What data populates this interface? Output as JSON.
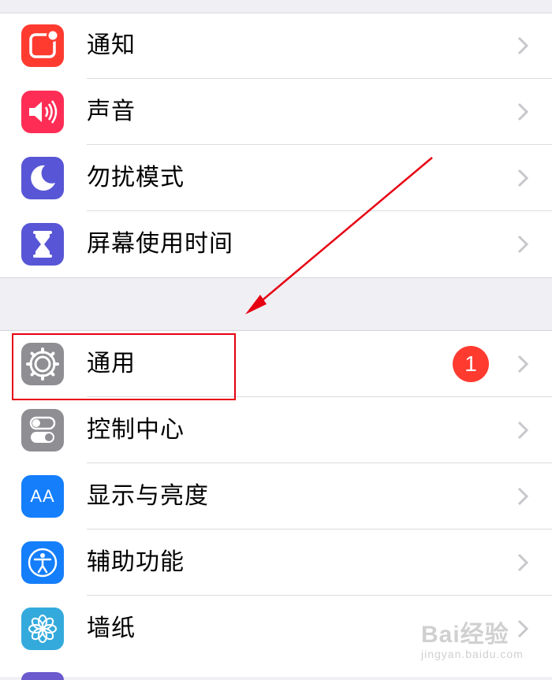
{
  "groups": {
    "top": [
      {
        "label": "通知",
        "icon": "notifications-icon",
        "color": "#ff3b30"
      },
      {
        "label": "声音",
        "icon": "sound-icon",
        "color": "#ff2d55"
      },
      {
        "label": "勿扰模式",
        "icon": "moon-icon",
        "color": "#5856d6"
      },
      {
        "label": "屏幕使用时间",
        "icon": "hourglass-icon",
        "color": "#5856d6"
      }
    ],
    "bottom": [
      {
        "label": "通用",
        "icon": "gear-icon",
        "color": "#8e8e93",
        "badge": "1"
      },
      {
        "label": "控制中心",
        "icon": "toggles-icon",
        "color": "#8e8e93"
      },
      {
        "label": "显示与亮度",
        "icon": "text-size-icon",
        "color": "#147efb",
        "icon_text": "AA"
      },
      {
        "label": "辅助功能",
        "icon": "accessibility-icon",
        "color": "#147efb"
      },
      {
        "label": "墙纸",
        "icon": "wallpaper-flower-icon",
        "color": "#34aadc"
      }
    ]
  },
  "annotation": {
    "highlight_color": "#e60012"
  },
  "watermark": {
    "main": "Bai经验",
    "sub": "jingyan.baidu.com"
  }
}
